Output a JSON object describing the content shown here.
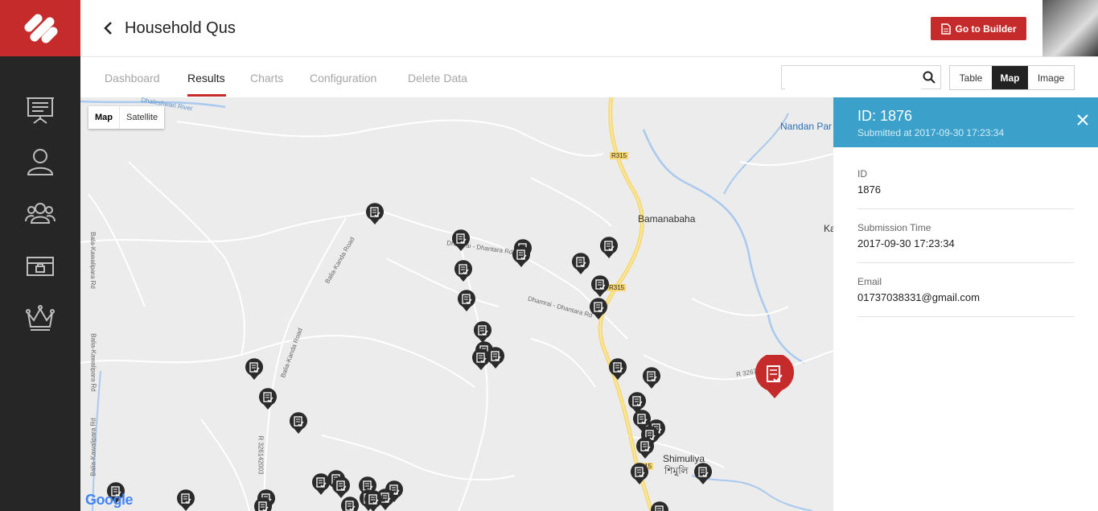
{
  "header": {
    "title": "Household Qus",
    "builder_label": "Go to Builder"
  },
  "tabs": [
    "Dashboard",
    "Results",
    "Charts",
    "Configuration",
    "Delete Data"
  ],
  "active_tab": "Results",
  "search": {
    "placeholder": ""
  },
  "view_toggle": [
    "Table",
    "Map",
    "Image"
  ],
  "active_view": "Map",
  "map": {
    "type_buttons": [
      "Map",
      "Satellite"
    ],
    "places": [
      "Nandan Par",
      "Bamanabaha",
      "Shimuliya",
      "শিমুলি",
      "Ka"
    ],
    "roads": [
      "R315",
      "R315",
      "R315",
      "Dhamrai - Dhantara Rd",
      "Dhamrai - Dhantara Rd",
      "Balia-Kanda Road",
      "Balia-Kanda Road",
      "Bala-Kawalipara Rd",
      "Balia-Kawalipara Rd",
      "Balia-Kawalipara Rd",
      "R 326142003",
      "R 326722002",
      "Dhaleshwari River"
    ],
    "google": "Google"
  },
  "detail": {
    "id_title": "ID: 1876",
    "submitted": "Submitted at 2017-09-30 17:23:34",
    "fields": [
      {
        "label": "ID",
        "value": "1876"
      },
      {
        "label": "Submission Time",
        "value": "2017-09-30 17:23:34"
      },
      {
        "label": "Email",
        "value": "01737038331@gmail.com"
      }
    ]
  },
  "colors": {
    "brand": "#c62b2b",
    "sidebar": "#262626",
    "panel_header": "#3ba1cb",
    "marker": "#2b2b2b"
  },
  "icons": [
    "logo-icon",
    "presentation-icon",
    "user-icon",
    "users-icon",
    "id-card-icon",
    "crown-icon",
    "back-chevron-icon",
    "document-icon",
    "search-icon",
    "close-icon",
    "submission-marker-icon"
  ]
}
